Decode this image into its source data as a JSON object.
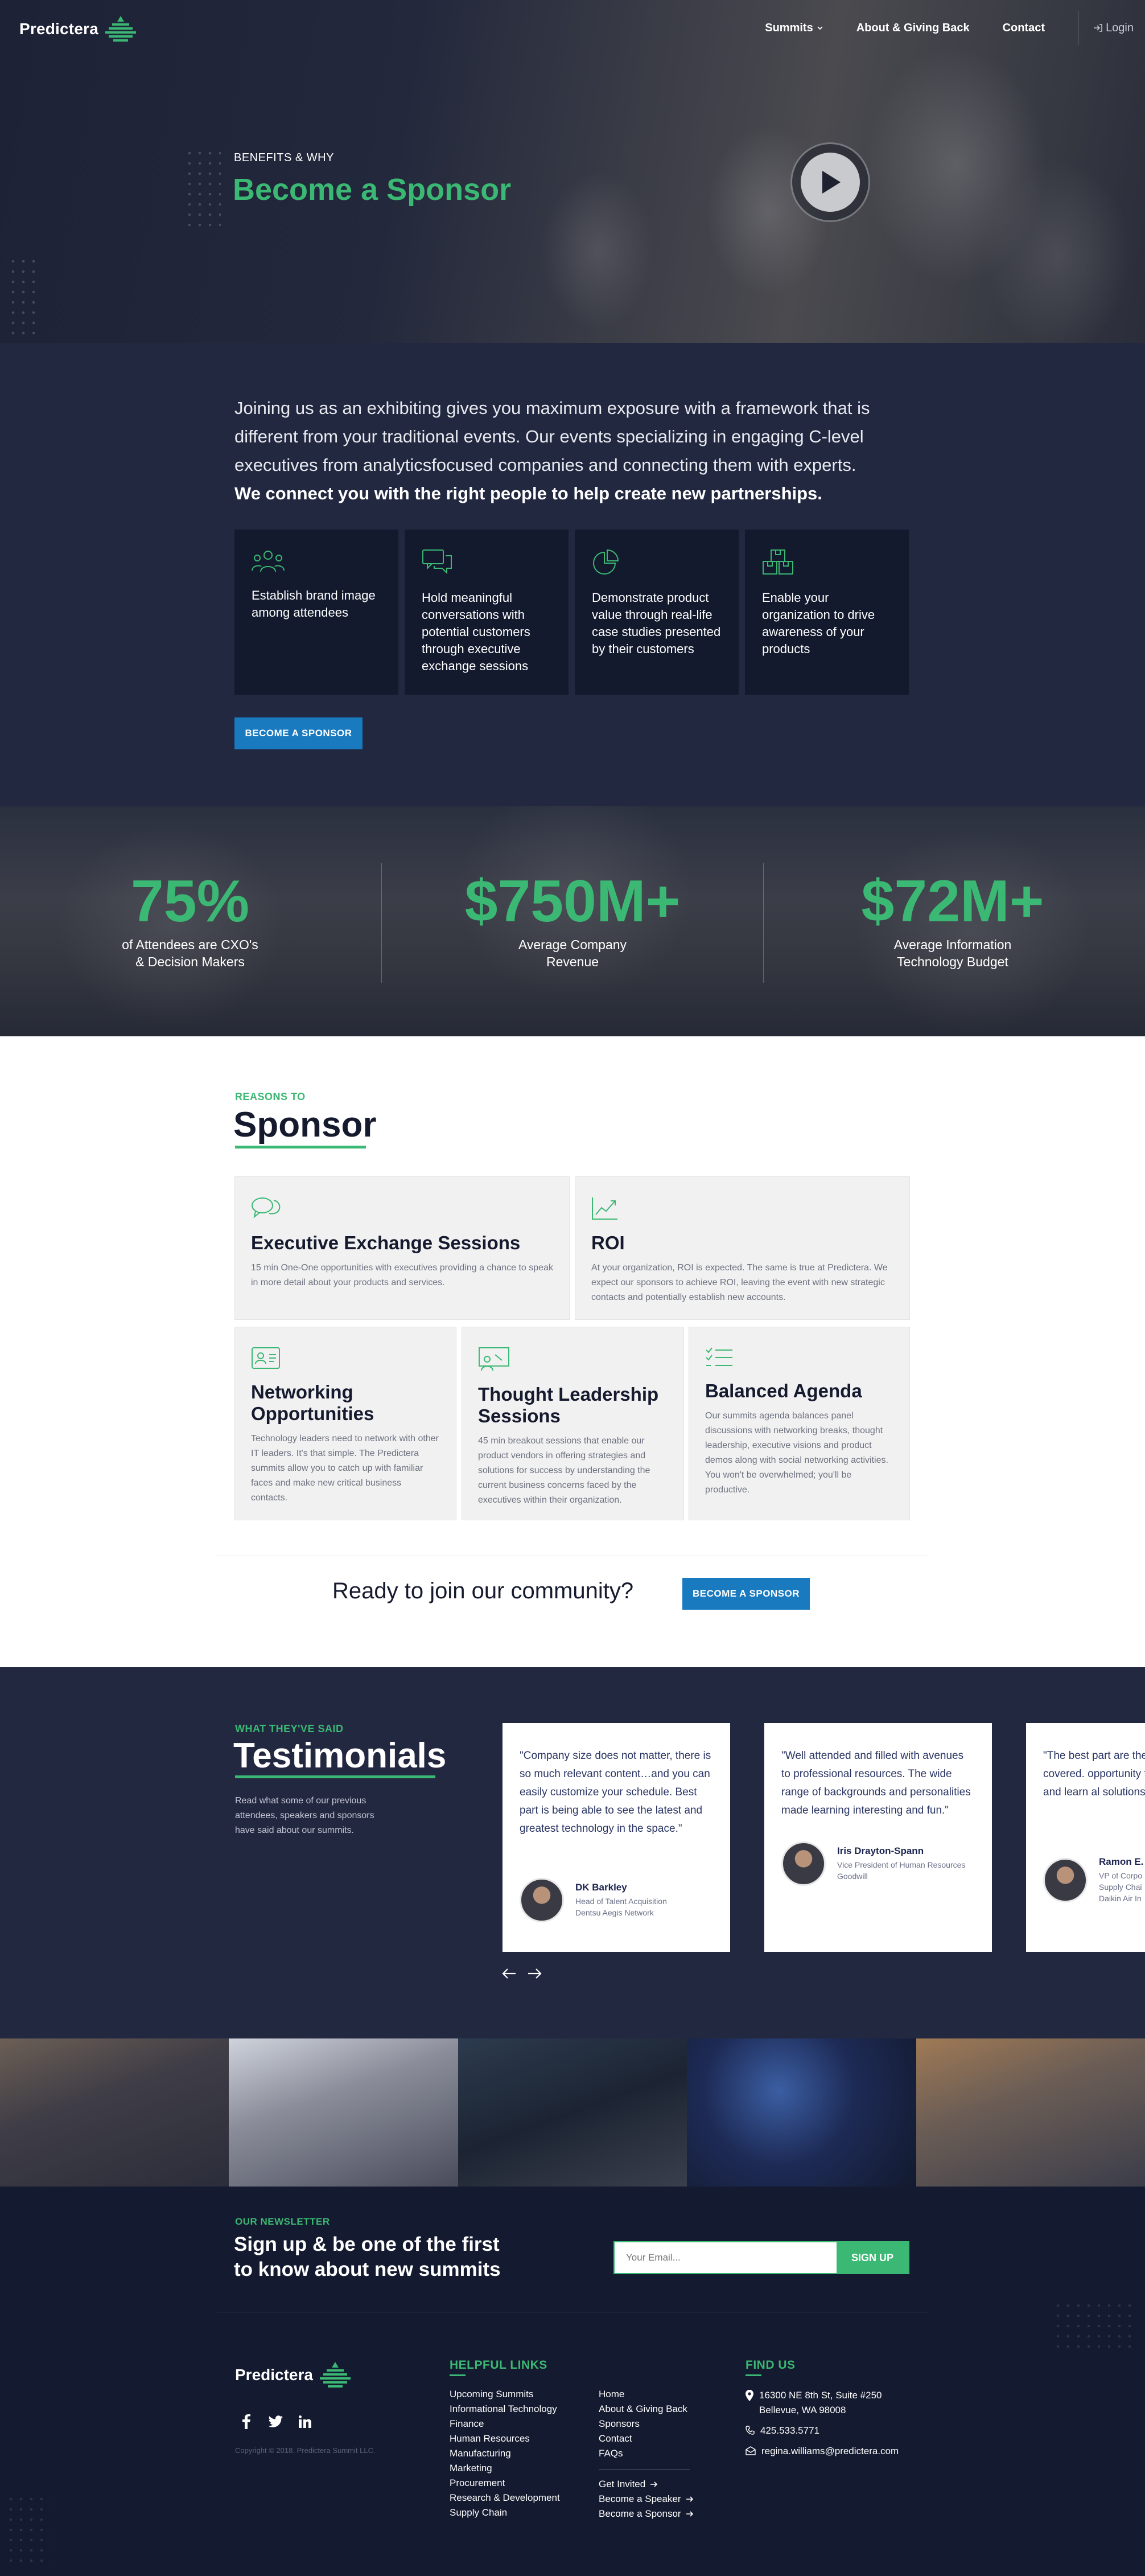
{
  "header": {
    "logo": "Predictera",
    "nav": [
      {
        "label": "Summits"
      },
      {
        "label": "About & Giving Back"
      },
      {
        "label": "Contact"
      }
    ],
    "login": "Login"
  },
  "hero": {
    "kicker": "BENEFITS & WHY",
    "title": "Become a Sponsor"
  },
  "intro": {
    "text": "Joining us as an exhibiting gives you maximum exposure with a framework that is different from your traditional events. Our events specializing in engaging C-level executives from analyticsfocused companies and connecting them with experts.",
    "bold": "We connect you with the right people to help create new partnerships.",
    "features": [
      {
        "icon": "users-icon",
        "text": "Establish brand image among attendees"
      },
      {
        "icon": "chat-icon",
        "text": "Hold meaningful conversations with potential customers through executive exchange sessions"
      },
      {
        "icon": "pie-chart-icon",
        "text": "Demonstrate product value through real-life case studies presented by their customers"
      },
      {
        "icon": "boxes-icon",
        "text": "Enable your organization to drive awareness of your products"
      }
    ],
    "cta": "BECOME A SPONSOR"
  },
  "stats": [
    {
      "value": "75%",
      "label1": "of Attendees are CXO's",
      "label2": "& Decision Makers"
    },
    {
      "value": "$750M+",
      "label1": "Average Company",
      "label2": "Revenue"
    },
    {
      "value": "$72M+",
      "label1": "Average Information",
      "label2": "Technology Budget"
    }
  ],
  "reasons": {
    "kicker": "REASONS TO",
    "title": "Sponsor",
    "items": [
      {
        "icon": "chat-bubbles-icon",
        "title": "Executive Exchange Sessions",
        "text": "15 min One-One opportunities with executives providing a chance to speak in more detail  about your products and services."
      },
      {
        "icon": "trending-up-icon",
        "title": "ROI",
        "text": "At your organization, ROI is expected. The same is true at Predictera. We expect our sponsors to achieve ROI, leaving the event with new strategic contacts and potentially establish new accounts."
      },
      {
        "icon": "id-card-icon",
        "title": "Networking Opportunities",
        "text": "Technology leaders need to network with other IT leaders. It's that simple. The Predictera summits allow you to catch up with familiar faces and make new critical business contacts."
      },
      {
        "icon": "presenter-icon",
        "title": "Thought Leadership Sessions",
        "text": "45 min breakout sessions that enable our product vendors in offering strategies and solutions for success by understanding the current business concerns faced by the executives within their organization."
      },
      {
        "icon": "checklist-icon",
        "title": "Balanced Agenda",
        "text": "Our summits agenda balances panel discussions with networking breaks, thought leadership, executive visions and product demos along with social networking activities. You won't be overwhelmed; you'll be productive."
      }
    ],
    "ready": "Ready to join our community?",
    "cta": "BECOME A SPONSOR"
  },
  "testimonials": {
    "kicker": "WHAT THEY'VE SAID",
    "title": "Testimonials",
    "desc": "Read what some of our previous attendees, speakers and sponsors have said about our summits.",
    "items": [
      {
        "quote": "\"Company size does not matter, there is so much relevant content…and you can easily customize your schedule. Best part is being able to see the latest and greatest technology in the space.\"",
        "name": "DK Barkley",
        "role": "Head of Talent Acquisition\nDentsu Aegis Network"
      },
      {
        "quote": "\"Well attended and filled with avenues to professional resources. The wide range of backgrounds and personalities made learning interesting and fun.\"",
        "name": "Iris Drayton-Spann",
        "role": "Vice President of Human Resources\nGoodwill"
      },
      {
        "quote": "\"The best part are the and topics covered. opportunity to hear network and learn al solutions in the field",
        "name": "Ramon E.",
        "role": "VP of Corpo\nSupply Chai\nDaikin Air In"
      }
    ]
  },
  "newsletter": {
    "kicker": "OUR NEWSLETTER",
    "title1": "Sign up & be one of the first",
    "title2": "to know about new summits",
    "placeholder": "Your Email...",
    "button": "SIGN UP"
  },
  "footer": {
    "logo": "Predictera",
    "copyright": "Copyright © 2018. Predictera Summit LLC.",
    "helpful_head": "HELPFUL LINKS",
    "links_col1": [
      "Upcoming Summits",
      "Informational Technology",
      "Finance",
      "Human Resources",
      "Manufacturing",
      "Marketing",
      "Procurement",
      "Research & Development",
      "Supply Chain"
    ],
    "links_col2": [
      "Home",
      "About & Giving Back",
      "Sponsors",
      "Contact",
      "FAQs"
    ],
    "links_col3": [
      "Get Invited",
      "Become a Speaker",
      "Become a Sponsor"
    ],
    "find_head": "FIND US",
    "address1": "16300 NE 8th St, Suite #250",
    "address2": "Bellevue, WA 98008",
    "phone": "425.533.5771",
    "email": "regina.williams@predictera.com"
  },
  "colors": {
    "accent": "#3bb873",
    "navy": "#232841",
    "button": "#1a7ac0"
  }
}
